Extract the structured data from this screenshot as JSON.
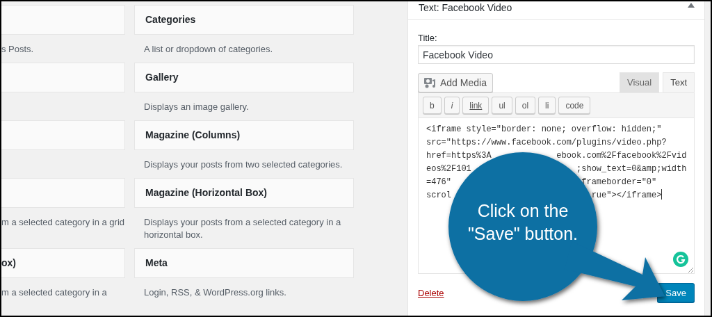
{
  "widgets": {
    "left_column": [
      {
        "kind": "card",
        "description": "s Posts."
      },
      {
        "kind": "card"
      },
      {
        "kind": "card"
      },
      {
        "kind": "card",
        "description": "m a selected category in a grid"
      },
      {
        "kind": "card",
        "title": "ox)",
        "description": "m a selected category in a"
      }
    ],
    "right_column": [
      {
        "kind": "card",
        "title": "Categories",
        "description": "A list or dropdown of categories."
      },
      {
        "kind": "card",
        "title": "Gallery",
        "description": "Displays an image gallery."
      },
      {
        "kind": "card",
        "title": "Magazine (Columns)",
        "description": "Displays your posts from two selected categories."
      },
      {
        "kind": "card",
        "title": "Magazine (Horizontal Box)",
        "description": "Displays your posts from a selected category in a horizontal box."
      },
      {
        "kind": "card",
        "title": "Meta",
        "description": "Login, RSS, & WordPress.org links."
      }
    ]
  },
  "widget_panel": {
    "header": "Text: Facebook Video",
    "expanded": true,
    "title_label": "Title:",
    "title_value": "Facebook Video",
    "add_media": "Add Media",
    "editor_tabs": [
      {
        "label": "Visual",
        "selected": false
      },
      {
        "label": "Text",
        "selected": true
      }
    ],
    "toolbar": [
      {
        "label": "b",
        "kind": "plain"
      },
      {
        "label": "i",
        "kind": "italic"
      },
      {
        "label": "link",
        "kind": "link"
      },
      {
        "label": "ul",
        "kind": "plain"
      },
      {
        "label": "ol",
        "kind": "plain"
      },
      {
        "label": "li",
        "kind": "plain"
      },
      {
        "label": "code",
        "kind": "plain"
      }
    ],
    "code_lines": [
      {
        "start": "<iframe style=\"border: none; overflow: hidden;\""
      },
      {
        "start": "src=\"https://www.facebook.com/plugins/video.php?"
      },
      {
        "start": "href=https%3A",
        "end": "ebook.com%2Ffacebook%2Fvid"
      },
      {
        "start": "eos%2F101",
        "end": ";show_text=0&amp;width"
      },
      {
        "start": "=476\"",
        "end": "frameborder=\"0\""
      },
      {
        "start": "scrol",
        "end": "rue\"></iframe>"
      }
    ],
    "delete_link": "Delete",
    "save_button": "Save"
  },
  "callout": {
    "text": "Click on the \"Save\" button."
  }
}
